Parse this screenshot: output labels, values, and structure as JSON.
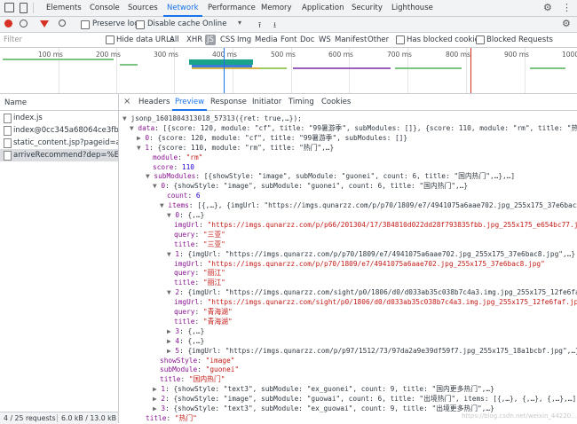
{
  "devtools": {
    "tabs": [
      "Elements",
      "Console",
      "Sources",
      "Network",
      "Performance",
      "Memory",
      "Application",
      "Security",
      "Lighthouse"
    ],
    "active_tab": "Network"
  },
  "toolbar": {
    "preserve_log": "Preserve log",
    "disable_cache": "Disable cache",
    "throttling": "Online"
  },
  "filterbar": {
    "placeholder": "Filter",
    "hide_data_urls": "Hide data URLs",
    "types": [
      "All",
      "XHR",
      "JS",
      "CSS",
      "Img",
      "Media",
      "Font",
      "Doc",
      "WS",
      "Manifest",
      "Other"
    ],
    "active_type": "JS",
    "has_blocked_cookies": "Has blocked cookies",
    "blocked_requests": "Blocked Requests"
  },
  "overview": {
    "ticks": [
      "100 ms",
      "200 ms",
      "300 ms",
      "400 ms",
      "500 ms",
      "600 ms",
      "700 ms",
      "800 ms",
      "900 ms",
      "1000"
    ]
  },
  "requests": {
    "header": "Name",
    "items": [
      "index.js",
      "index@0cc345a68064ce3fb77...",
      "static_content.jsp?pageid=ap...",
      "arriveRecommend?dep=%E5..."
    ],
    "selected_index": 3
  },
  "statusbar": {
    "requests": "4 / 25 requests",
    "size": "6.0 kB / 13.0 kB t"
  },
  "detail": {
    "tabs": [
      "Headers",
      "Preview",
      "Response",
      "Initiator",
      "Timing",
      "Cookies"
    ],
    "active": "Preview"
  },
  "preview": {
    "lines": [
      {
        "t": "▼",
        "parts": [
          [
            "p",
            "jsonp_1601804313018_57313({ret: true,…});"
          ]
        ]
      },
      {
        "t": "▼",
        "parts": [
          [
            "k",
            "data"
          ],
          [
            "p",
            ": [{score: 120, module: \"cf\", title: \"99暑游季\", subModules: []}, {score: 110, module: \"rm\", title: \"热门\",…}]"
          ]
        ]
      },
      {
        "t": "▶",
        "parts": [
          [
            "k",
            "0"
          ],
          [
            "p",
            ": {score: 120, module: \"cf\", title: \"99暑游季\", subModules: []}"
          ]
        ]
      },
      {
        "t": "▼",
        "parts": [
          [
            "k",
            "1"
          ],
          [
            "p",
            ": {score: 110, module: \"rm\", title: \"热门\",…}"
          ]
        ]
      },
      {
        "t": "",
        "parts": [
          [
            "k",
            "module"
          ],
          [
            "p",
            ": "
          ],
          [
            "s",
            "\"rm\""
          ]
        ]
      },
      {
        "t": "",
        "parts": [
          [
            "k",
            "score"
          ],
          [
            "p",
            ": "
          ],
          [
            "n",
            "110"
          ]
        ]
      },
      {
        "t": "▼",
        "parts": [
          [
            "k",
            "subModules"
          ],
          [
            "p",
            ": [{showStyle: \"image\", subModule: \"guonei\", count: 6, title: \"国内热门\",…},…]"
          ]
        ]
      },
      {
        "t": "▼",
        "parts": [
          [
            "k",
            "0"
          ],
          [
            "p",
            ": {showStyle: \"image\", subModule: \"guonei\", count: 6, title: \"国内热门\",…}"
          ]
        ]
      },
      {
        "t": "",
        "parts": [
          [
            "k",
            "count"
          ],
          [
            "p",
            ": "
          ],
          [
            "n",
            "6"
          ]
        ]
      },
      {
        "t": "▼",
        "parts": [
          [
            "k",
            "items"
          ],
          [
            "p",
            ": [{,…}, {imgUrl: \"https://imgs.qunarzz.com/p/p70/1809/e7/4941075a6aae702.jpg_255x175_37e6bac8.jpg\",…"
          ]
        ]
      },
      {
        "t": "▼",
        "parts": [
          [
            "k",
            "0"
          ],
          [
            "p",
            ": {,…}"
          ]
        ]
      },
      {
        "t": "",
        "parts": [
          [
            "k",
            "imgUrl"
          ],
          [
            "p",
            ": "
          ],
          [
            "s",
            "\"https://imgs.qunarzz.com/p/p66/201304/17/384810d022dd28f793835fbb.jpg_255x175_e654bc77.jpg\""
          ]
        ]
      },
      {
        "t": "",
        "parts": [
          [
            "k",
            "query"
          ],
          [
            "p",
            ": "
          ],
          [
            "s",
            "\"三亚\""
          ]
        ]
      },
      {
        "t": "",
        "parts": [
          [
            "k",
            "title"
          ],
          [
            "p",
            ": "
          ],
          [
            "s",
            "\"三亚\""
          ]
        ]
      },
      {
        "t": "▼",
        "parts": [
          [
            "k",
            "1"
          ],
          [
            "p",
            ": {imgUrl: \"https://imgs.qunarzz.com/p/p70/1809/e7/4941075a6aae702.jpg_255x175_37e6bac8.jpg\",…}"
          ]
        ]
      },
      {
        "t": "",
        "parts": [
          [
            "k",
            "imgUrl"
          ],
          [
            "p",
            ": "
          ],
          [
            "s",
            "\"https://imgs.qunarzz.com/p/p70/1809/e7/4941075a6aae702.jpg_255x175_37e6bac8.jpg\""
          ]
        ]
      },
      {
        "t": "",
        "parts": [
          [
            "k",
            "query"
          ],
          [
            "p",
            ": "
          ],
          [
            "s",
            "\"丽江\""
          ]
        ]
      },
      {
        "t": "",
        "parts": [
          [
            "k",
            "title"
          ],
          [
            "p",
            ": "
          ],
          [
            "s",
            "\"丽江\""
          ]
        ]
      },
      {
        "t": "▼",
        "parts": [
          [
            "k",
            "2"
          ],
          [
            "p",
            ": {imgUrl: \"https://imgs.qunarzz.com/sight/p0/1806/d0/d033ab35c038b7c4a3.img.jpg_255x175_12fe6faf.jpg\","
          ]
        ]
      },
      {
        "t": "",
        "parts": [
          [
            "k",
            "imgUrl"
          ],
          [
            "p",
            ": "
          ],
          [
            "s",
            "\"https://imgs.qunarzz.com/sight/p0/1806/d0/d033ab35c038b7c4a3.img.jpg_255x175_12fe6faf.jpg\""
          ]
        ]
      },
      {
        "t": "",
        "parts": [
          [
            "k",
            "query"
          ],
          [
            "p",
            ": "
          ],
          [
            "s",
            "\"青海湖\""
          ]
        ]
      },
      {
        "t": "",
        "parts": [
          [
            "k",
            "title"
          ],
          [
            "p",
            ": "
          ],
          [
            "s",
            "\"青海湖\""
          ]
        ]
      },
      {
        "t": "▶",
        "parts": [
          [
            "k",
            "3"
          ],
          [
            "p",
            ": {,…}"
          ]
        ]
      },
      {
        "t": "▶",
        "parts": [
          [
            "k",
            "4"
          ],
          [
            "p",
            ": {,…}"
          ]
        ]
      },
      {
        "t": "▶",
        "parts": [
          [
            "k",
            "5"
          ],
          [
            "p",
            ": {imgUrl: \"https://imgs.qunarzz.com/p/p97/1512/73/97da2a9e39df59f7.jpg_255x175_18a1bcbf.jpg\",…}"
          ]
        ]
      },
      {
        "t": "",
        "parts": [
          [
            "k",
            "showStyle"
          ],
          [
            "p",
            ": "
          ],
          [
            "s",
            "\"image\""
          ]
        ]
      },
      {
        "t": "",
        "parts": [
          [
            "k",
            "subModule"
          ],
          [
            "p",
            ": "
          ],
          [
            "s",
            "\"guonei\""
          ]
        ]
      },
      {
        "t": "",
        "parts": [
          [
            "k",
            "title"
          ],
          [
            "p",
            ": "
          ],
          [
            "s",
            "\"国内热门\""
          ]
        ]
      },
      {
        "t": "▶",
        "parts": [
          [
            "k",
            "1"
          ],
          [
            "p",
            ": {showStyle: \"text3\", subModule: \"ex_guonei\", count: 9, title: \"国内更多热门\",…}"
          ]
        ]
      },
      {
        "t": "▶",
        "parts": [
          [
            "k",
            "2"
          ],
          [
            "p",
            ": {showStyle: \"image\", subModule: \"guowai\", count: 6, title: \"出境热门\", items: [{,…}, {,…}, {,…},…]}"
          ]
        ]
      },
      {
        "t": "▶",
        "parts": [
          [
            "k",
            "3"
          ],
          [
            "p",
            ": {showStyle: \"text3\", subModule: \"ex_guowai\", count: 9, title: \"出境更多热门\",…}"
          ]
        ]
      },
      {
        "t": "",
        "parts": [
          [
            "k",
            "title"
          ],
          [
            "p",
            ": "
          ],
          [
            "s",
            "\"热门\""
          ]
        ]
      }
    ]
  },
  "watermark": "https://blog.csdn.net/weixin_44220..."
}
